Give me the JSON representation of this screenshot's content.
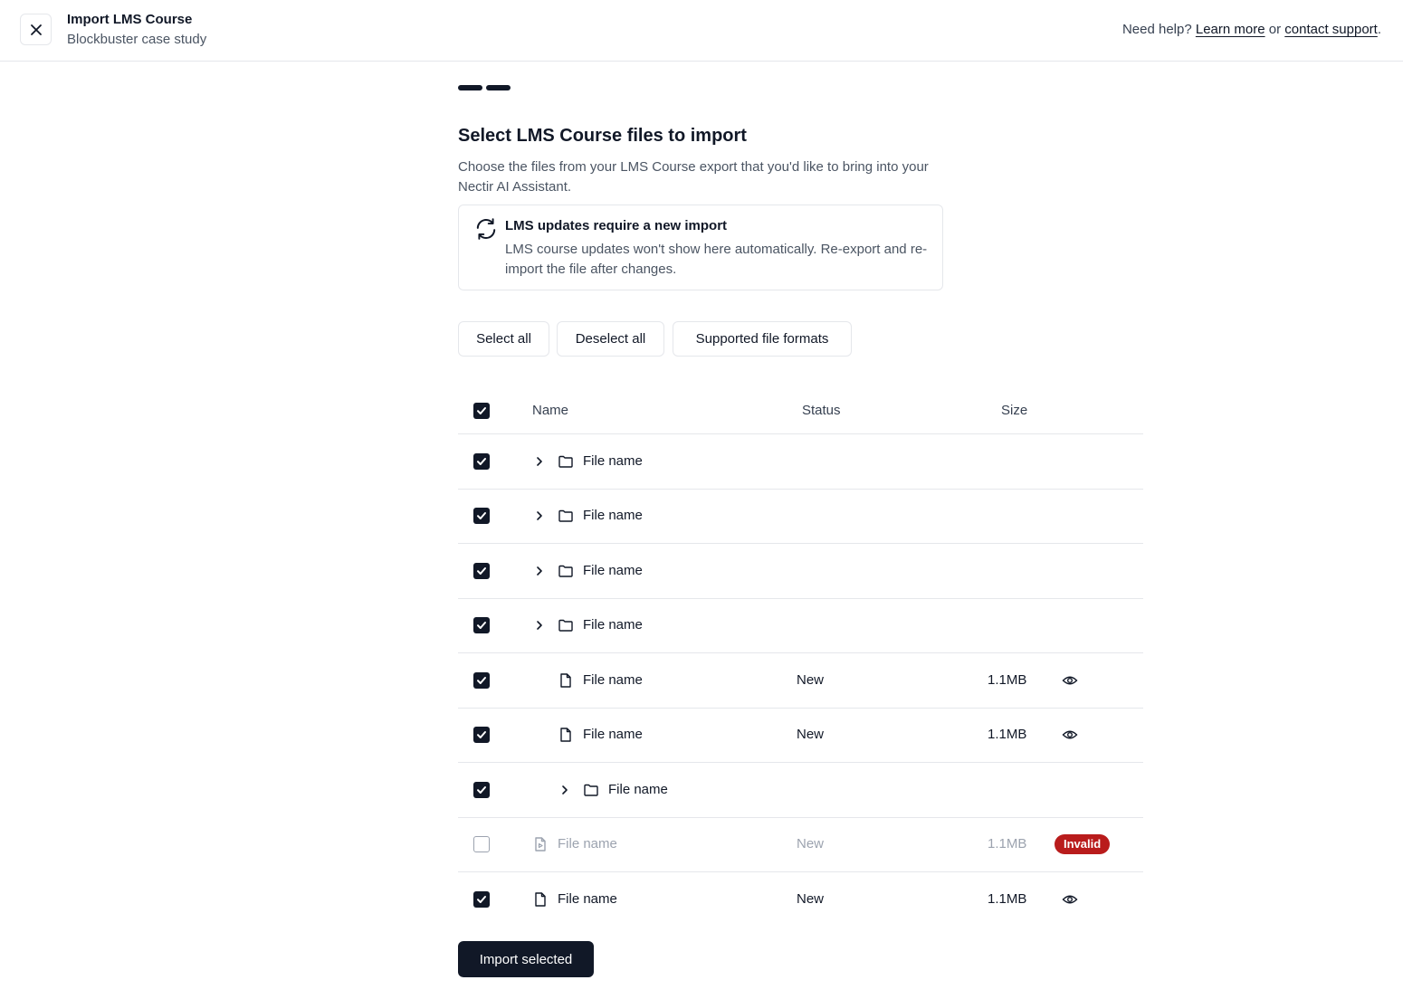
{
  "header": {
    "title": "Import LMS Course",
    "subtitle": "Blockbuster case study",
    "help_prefix": "Need help?",
    "learn_more": "Learn more",
    "or": "or",
    "contact_support": "contact support",
    "period": "."
  },
  "main": {
    "title": "Select LMS Course files to import",
    "description": "Choose the files from your LMS Course export that you'd like to bring into your Nectir AI Assistant."
  },
  "info": {
    "title": "LMS updates require a new import",
    "body": "LMS course updates won't show here automatically. Re-export and re-import the file after changes."
  },
  "actions": {
    "select_all": "Select all",
    "deselect_all": "Deselect all",
    "supported_formats": "Supported file formats"
  },
  "table": {
    "columns": {
      "name": "Name",
      "status": "Status",
      "size": "Size"
    },
    "rows": [
      {
        "name": "File name",
        "status": "",
        "size": ""
      },
      {
        "name": "File name",
        "status": "",
        "size": ""
      },
      {
        "name": "File name",
        "status": "",
        "size": ""
      },
      {
        "name": "File name",
        "status": "",
        "size": ""
      },
      {
        "name": "File name",
        "status": "New",
        "size": "1.1MB"
      },
      {
        "name": "File name",
        "status": "New",
        "size": "1.1MB"
      },
      {
        "name": "File name",
        "status": "",
        "size": ""
      },
      {
        "name": "File name",
        "status": "New",
        "size": "1.1MB",
        "badge": "Invalid"
      },
      {
        "name": "File name",
        "status": "New",
        "size": "1.1MB"
      }
    ]
  },
  "import_label": "Import selected",
  "colors": {
    "primary": "#111827",
    "invalid": "#b91c1c",
    "border": "#e5e7eb"
  }
}
